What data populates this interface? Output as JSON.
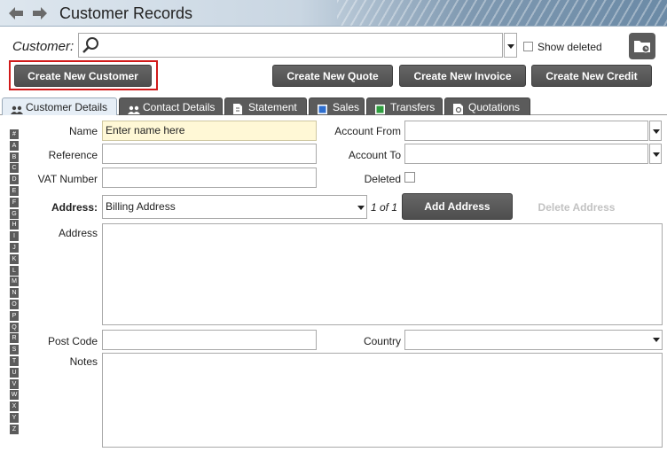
{
  "window": {
    "title": "Customer Records"
  },
  "customer_bar": {
    "label": "Customer:",
    "search_value": "",
    "show_deleted_label": "Show deleted",
    "show_deleted_checked": false
  },
  "actions": {
    "create_new_customer": "Create New Customer",
    "create_new_quote": "Create New Quote",
    "create_new_invoice": "Create New Invoice",
    "create_new_credit": "Create New Credit"
  },
  "tabs": [
    {
      "label": "Customer Details",
      "icon": "people-icon",
      "active": true
    },
    {
      "label": "Contact Details",
      "icon": "people-icon",
      "active": false
    },
    {
      "label": "Statement",
      "icon": "document-icon",
      "active": false
    },
    {
      "label": "Sales",
      "icon": "blue-square-icon",
      "active": false
    },
    {
      "label": "Transfers",
      "icon": "green-square-icon",
      "active": false
    },
    {
      "label": "Quotations",
      "icon": "quotation-icon",
      "active": false
    }
  ],
  "alpha_index": [
    "#",
    "A",
    "B",
    "C",
    "D",
    "E",
    "F",
    "G",
    "H",
    "I",
    "J",
    "K",
    "L",
    "M",
    "N",
    "O",
    "P",
    "Q",
    "R",
    "S",
    "T",
    "U",
    "V",
    "W",
    "X",
    "Y",
    "Z"
  ],
  "form": {
    "name_label": "Name",
    "name_value": "Enter name here",
    "reference_label": "Reference",
    "reference_value": "",
    "vat_label": "VAT Number",
    "vat_value": "",
    "account_from_label": "Account From",
    "account_from_value": "",
    "account_to_label": "Account To",
    "account_to_value": "",
    "deleted_label": "Deleted",
    "deleted_checked": false,
    "address_type_label": "Address:",
    "address_type_value": "Billing Address",
    "address_page": "1 of 1",
    "add_address": "Add Address",
    "delete_address": "Delete Address",
    "address_label": "Address",
    "address_value": "",
    "postcode_label": "Post Code",
    "postcode_value": "",
    "country_label": "Country",
    "country_value": "",
    "notes_label": "Notes",
    "notes_value": ""
  },
  "colors": {
    "button_dark": "#5b5b5b",
    "highlight_border": "#d11a1a",
    "name_field_bg": "#fff8d6",
    "active_tab_bg": "#e6eef6"
  }
}
